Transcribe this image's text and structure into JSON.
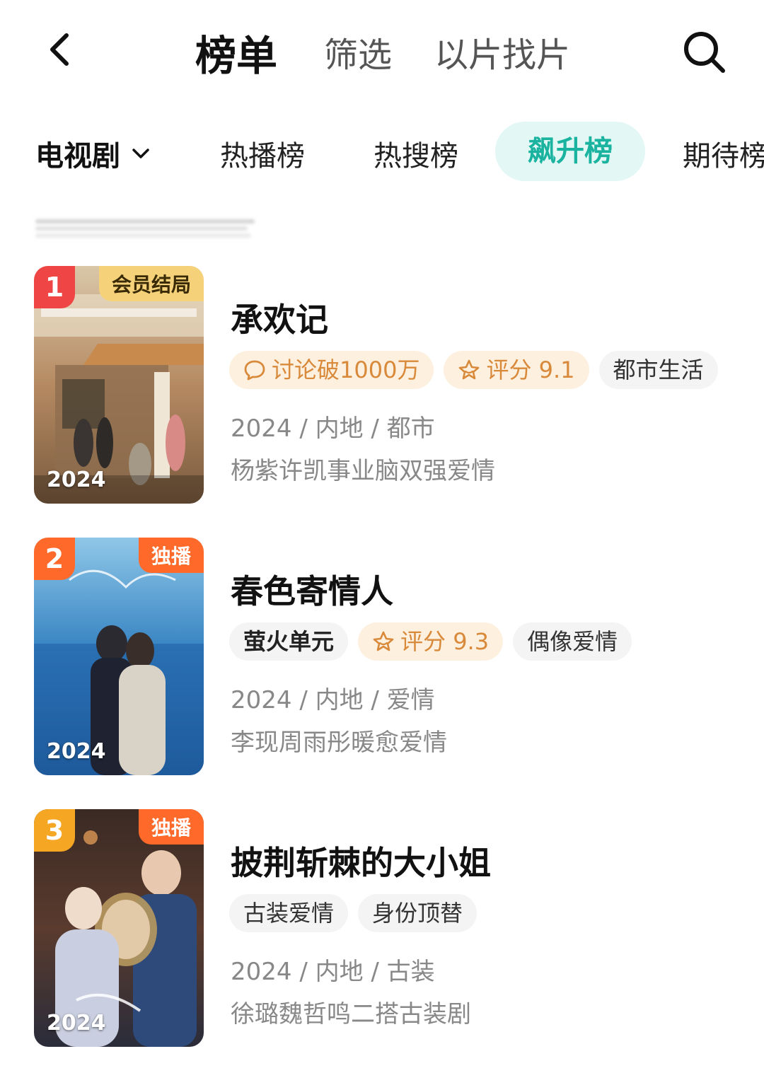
{
  "nav": {
    "tabs": [
      "榜单",
      "筛选",
      "以片找片"
    ]
  },
  "categories": {
    "selected": "电视剧",
    "tabs": [
      "热播榜",
      "热搜榜",
      "飙升榜",
      "期待榜"
    ]
  },
  "items": [
    {
      "rank": "1",
      "rank_color": "#f04545",
      "corner_badge": "会员结局",
      "year": "2024",
      "title": "承欢记",
      "tags": [
        {
          "text": "讨论破1000万",
          "icon": "chat-bubble-icon"
        },
        {
          "text": "评分 9.1",
          "icon": "star-icon"
        },
        {
          "text": "都市生活"
        }
      ],
      "meta": "2024 / 内地 / 都市",
      "desc": "杨紫许凯事业脑双强爱情"
    },
    {
      "rank": "2",
      "rank_color": "#ff6a2a",
      "corner_badge": "独播",
      "year": "2024",
      "title": "春色寄情人",
      "tags": [
        {
          "text": "萤火单元"
        },
        {
          "text": "评分 9.3",
          "icon": "star-icon"
        },
        {
          "text": "偶像爱情"
        }
      ],
      "meta": "2024 / 内地 / 爱情",
      "desc": "李现周雨彤暖愈爱情"
    },
    {
      "rank": "3",
      "rank_color": "#f5a623",
      "corner_badge": "独播",
      "year": "2024",
      "title": "披荆斩棘的大小姐",
      "tags": [
        {
          "text": "古装爱情"
        },
        {
          "text": "身份顶替"
        }
      ],
      "meta": "2024 / 内地 / 古装",
      "desc": "徐璐魏哲鸣二搭古装剧"
    }
  ],
  "colors": {
    "accent": "#19b3a0",
    "accent_bg": "#e3f7f4",
    "warm_tag_bg": "#fdf0df",
    "warm_tag_text": "#d9893a"
  }
}
